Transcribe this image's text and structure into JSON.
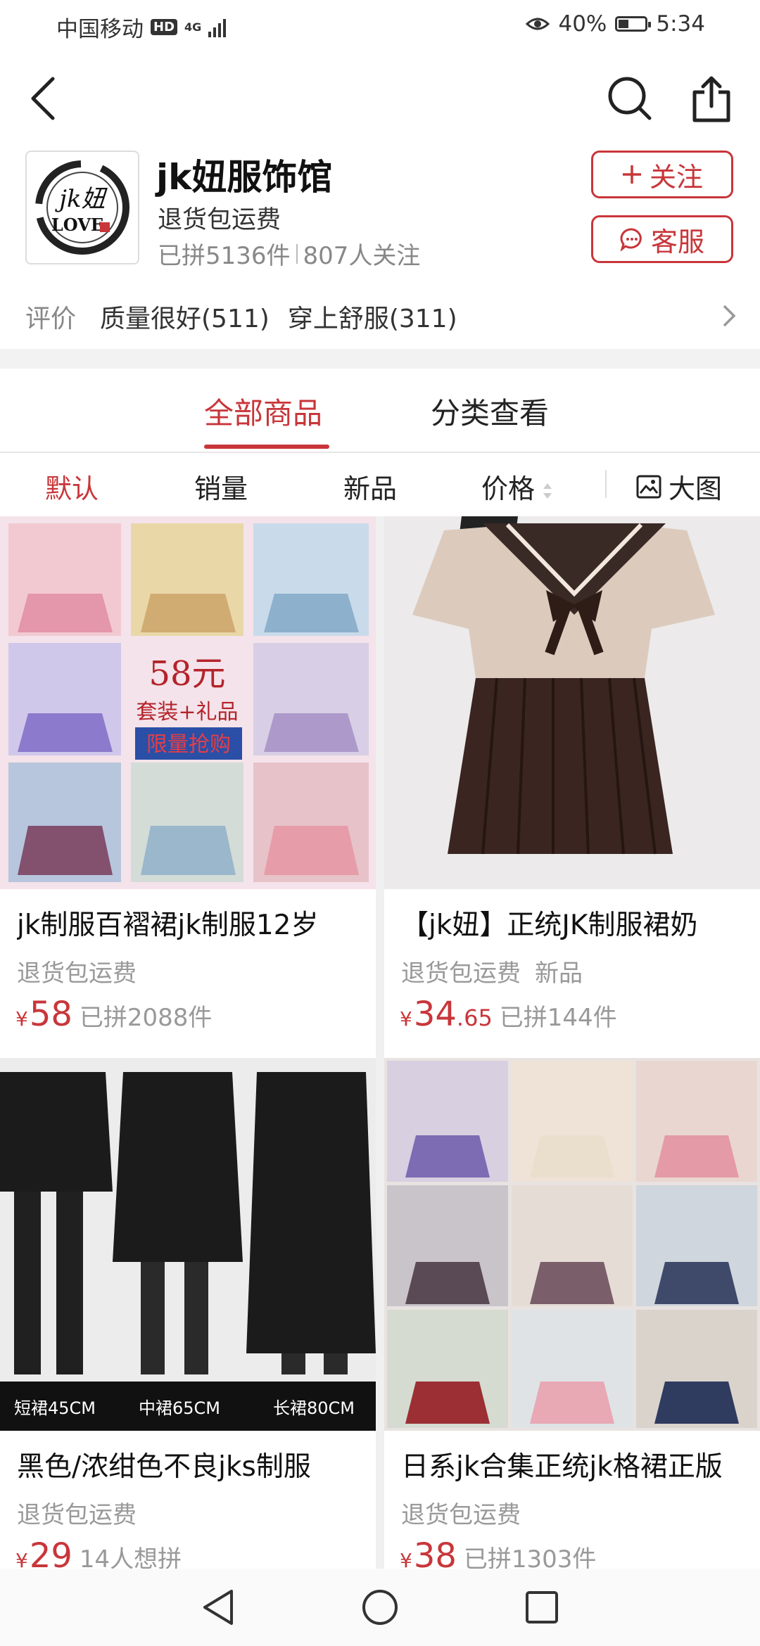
{
  "status_bar": {
    "carrier": "中国移动",
    "hd": "HD",
    "network": "4G",
    "battery_pct": "40%",
    "battery_level": 0.4,
    "time": "5:34"
  },
  "nav": {
    "back_icon": "back-arrow-icon",
    "search_icon": "search-icon",
    "share_icon": "share-icon"
  },
  "shop": {
    "logo_text_top": "jk妞",
    "logo_text_bottom": "LOVE",
    "name": "jk妞服饰馆",
    "tag": "退货包运费",
    "stats_sold": "已拼5136件",
    "stats_followers": "807人关注",
    "follow_button": "关注",
    "service_button": "客服"
  },
  "rating": {
    "label": "评价",
    "tags": [
      "质量很好(511)",
      "穿上舒服(311)"
    ]
  },
  "tabs": [
    {
      "label": "全部商品",
      "active": true
    },
    {
      "label": "分类查看",
      "active": false
    }
  ],
  "sort": {
    "default": "默认",
    "sales": "销量",
    "new": "新品",
    "price": "价格",
    "big_image": "大图"
  },
  "products": [
    {
      "title": "jk制服百褶裙jk制服12岁",
      "tags": [
        "退货包运费"
      ],
      "currency": "¥",
      "price_int": "58",
      "price_dec": "",
      "sold": "已拼2088件",
      "image_caption_price": "58元",
      "image_caption_sub": "套装+礼品",
      "image_caption_badge": "限量抢购"
    },
    {
      "title": "【jk妞】正统JK制服裙奶",
      "tags": [
        "退货包运费",
        "新品"
      ],
      "currency": "¥",
      "price_int": "34",
      "price_dec": ".65",
      "sold": "已拼144件"
    },
    {
      "title": "黑色/浓绀色不良jks制服",
      "tags": [
        "退货包运费"
      ],
      "currency": "¥",
      "price_int": "29",
      "price_dec": "",
      "sold": "14人想拼",
      "image_labels": [
        "短裙45CM",
        "中裙65CM",
        "长裙80CM"
      ]
    },
    {
      "title": "日系jk合集正统jk格裙正版",
      "tags": [
        "退货包运费"
      ],
      "currency": "¥",
      "price_int": "38",
      "price_dec": "",
      "sold": "已拼1303件"
    }
  ],
  "colors": {
    "accent": "#c8363a",
    "muted": "#999999"
  }
}
